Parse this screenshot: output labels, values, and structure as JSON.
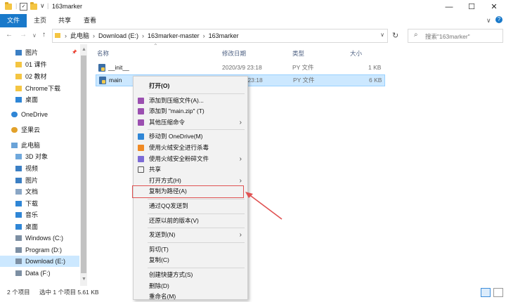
{
  "window": {
    "title": "163marker",
    "minimize": "—",
    "maximize": "☐",
    "close": "✕"
  },
  "ribbon": {
    "tabs": [
      "文件",
      "主页",
      "共享",
      "查看"
    ]
  },
  "address": {
    "crumbs": [
      "此电脑",
      "Download (E:)",
      "163marker-master",
      "163marker"
    ],
    "search_placeholder": "搜索\"163marker\""
  },
  "sidebar": {
    "items": [
      {
        "label": "图片",
        "icon": "pictures-icon",
        "pinned": true
      },
      {
        "label": "01 课件",
        "icon": "folder-icon"
      },
      {
        "label": "02 教材",
        "icon": "folder-icon"
      },
      {
        "label": "Chrome下载",
        "icon": "folder-icon"
      },
      {
        "label": "桌面",
        "icon": "desktop-icon"
      },
      {
        "label": "OneDrive",
        "icon": "onedrive-icon"
      },
      {
        "label": "坚果云",
        "icon": "nutstore-icon"
      },
      {
        "label": "此电脑",
        "icon": "computer-icon"
      },
      {
        "label": "3D 对象",
        "icon": "3d-objects-icon"
      },
      {
        "label": "视频",
        "icon": "videos-icon"
      },
      {
        "label": "图片",
        "icon": "pictures-icon"
      },
      {
        "label": "文档",
        "icon": "documents-icon"
      },
      {
        "label": "下载",
        "icon": "downloads-icon"
      },
      {
        "label": "音乐",
        "icon": "music-icon"
      },
      {
        "label": "桌面",
        "icon": "desktop-icon"
      },
      {
        "label": "Windows (C:)",
        "icon": "drive-icon"
      },
      {
        "label": "Program (D:)",
        "icon": "drive-icon"
      },
      {
        "label": "Download (E:)",
        "icon": "drive-icon",
        "selected": true
      },
      {
        "label": "Data (F:)",
        "icon": "drive-icon"
      }
    ]
  },
  "columns": [
    "名称",
    "修改日期",
    "类型",
    "大小"
  ],
  "files": [
    {
      "name": "__init__",
      "date": "2020/3/9 23:18",
      "type": "PY 文件",
      "size": "1 KB"
    },
    {
      "name": "main",
      "date": "2020/3/9 23:18",
      "type": "PY 文件",
      "size": "6 KB"
    }
  ],
  "status": {
    "count": "2 个项目",
    "selection": "选中 1 个项目  5.61 KB"
  },
  "context_menu": {
    "items": [
      {
        "label": "打开(O)",
        "bold": true
      },
      {
        "sep": true
      },
      {
        "label": "添加到压缩文件(A)...",
        "icon": "winrar-icon"
      },
      {
        "label": "添加到 \"main.zip\" (T)",
        "icon": "winrar-icon"
      },
      {
        "label": "其他压缩命令",
        "icon": "winrar-icon",
        "submenu": true
      },
      {
        "sep": true
      },
      {
        "label": "移动到 OneDrive(M)",
        "icon": "onedrive-icon"
      },
      {
        "label": "使用火绒安全进行杀毒",
        "icon": "huorong-icon"
      },
      {
        "label": "使用火绒安全粉碎文件",
        "icon": "shredder-icon",
        "submenu": true
      },
      {
        "label": "共享",
        "icon": "share-icon"
      },
      {
        "label": "打开方式(H)",
        "submenu": true
      },
      {
        "label": "复制为路径(A)",
        "highlighted": true
      },
      {
        "sep": true
      },
      {
        "label": "通过QQ发送到"
      },
      {
        "sep": true
      },
      {
        "label": "还原以前的版本(V)"
      },
      {
        "sep": true
      },
      {
        "label": "发送到(N)",
        "submenu": true
      },
      {
        "sep": true
      },
      {
        "label": "剪切(T)"
      },
      {
        "label": "复制(C)"
      },
      {
        "sep": true
      },
      {
        "label": "创建快捷方式(S)"
      },
      {
        "label": "删除(D)"
      },
      {
        "label": "重命名(M)"
      }
    ]
  },
  "colors": {
    "accent": "#1979ca",
    "selection": "#cce8ff",
    "highlight_box": "#e05252"
  }
}
